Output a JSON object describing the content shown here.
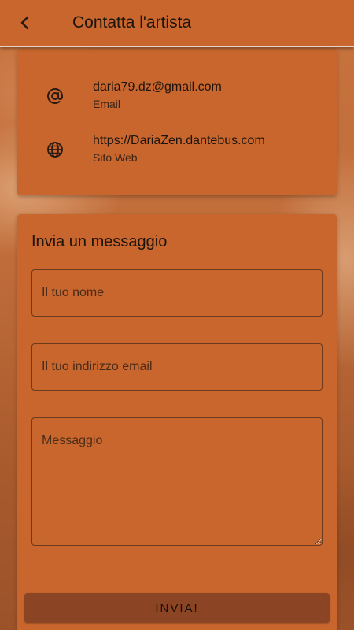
{
  "header": {
    "title": "Contatta l'artista",
    "back_icon": "chevron-left-icon"
  },
  "contact": {
    "email": {
      "value": "daria79.dz@gmail.com",
      "label": "Email",
      "icon": "at-sign-icon"
    },
    "website": {
      "value": "https://DariaZen.dantebus.com",
      "label": "Sito Web",
      "icon": "globe-icon"
    }
  },
  "form": {
    "title": "Invia un messaggio",
    "name_placeholder": "Il tuo nome",
    "email_placeholder": "Il tuo indirizzo email",
    "message_placeholder": "Messaggio",
    "submit_label": "INVIA!"
  },
  "colors": {
    "primary": "#c8662e",
    "button": "#8b4424",
    "text": "#1c130c"
  }
}
